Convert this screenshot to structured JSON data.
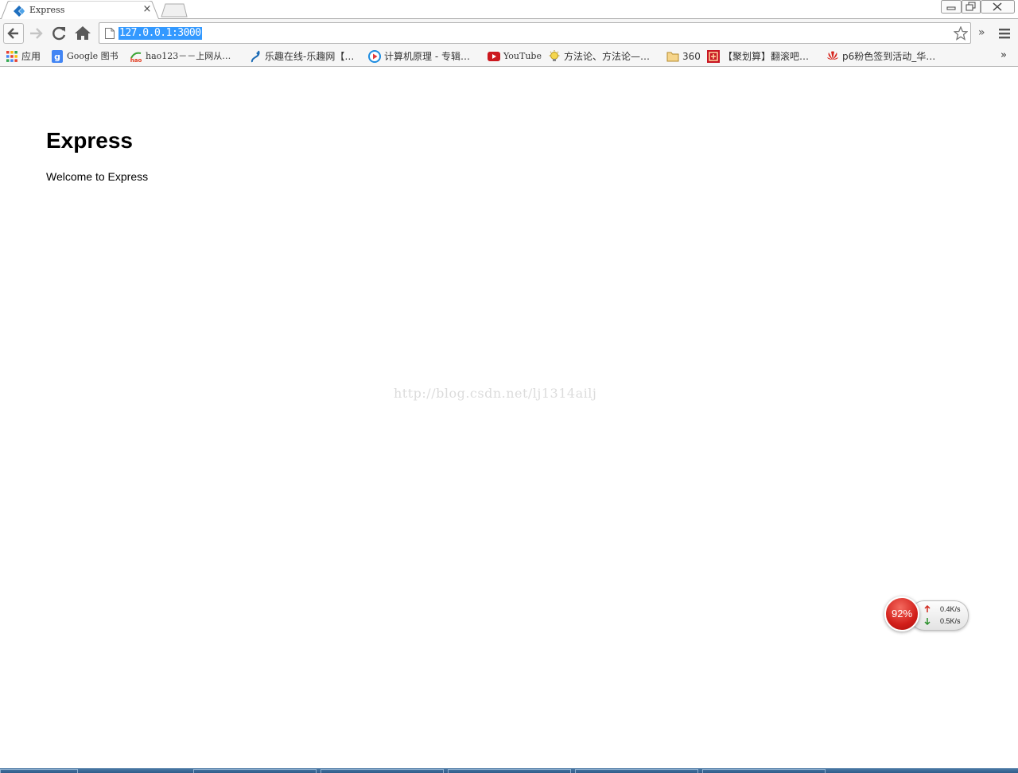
{
  "browser": {
    "tab": {
      "title": "Express",
      "close_glyph": "×"
    },
    "window_controls": [
      "minimize",
      "maximize",
      "close"
    ],
    "toolbar": {
      "url": "127.0.0.1:3000",
      "more_glyph": "»"
    },
    "bookmarks": [
      {
        "label": "应用",
        "icon": "apps-grid-icon"
      },
      {
        "label": "Google 图书",
        "icon": "google-books-icon"
      },
      {
        "label": "hao123－－上网从…",
        "icon": "hao123-icon"
      },
      {
        "label": "乐趣在线-乐趣网【…",
        "icon": "lequ-icon"
      },
      {
        "label": "计算机原理 - 专辑…",
        "icon": "youku-icon"
      },
      {
        "label": "YouTube",
        "icon": "youtube-icon"
      },
      {
        "label": "方法论、方法论—…",
        "icon": "lightbulb-icon"
      },
      {
        "label": "360",
        "icon": "folder-icon"
      },
      {
        "label": "【聚划算】翻滚吧…",
        "icon": "juhuasuan-icon"
      },
      {
        "label": "p6粉色签到活动_华…",
        "icon": "huawei-icon"
      }
    ],
    "bookmarks_more_glyph": "»"
  },
  "page": {
    "title": "Express",
    "text": "Welcome to Express",
    "watermark": "http://blog.csdn.net/lj1314ailj"
  },
  "net_widget": {
    "percent": "92%",
    "upload": "0.4K/s",
    "download": "0.5K/s",
    "ball_color": "#d21f1a"
  },
  "colors": {
    "url_highlight": "#3399ff",
    "taskbar": "#3a6893"
  }
}
